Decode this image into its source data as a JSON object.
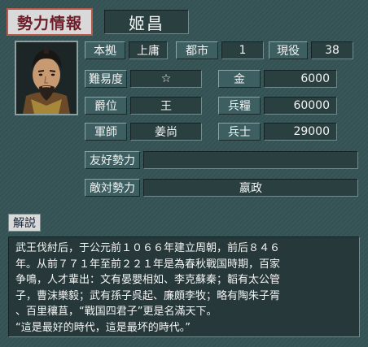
{
  "header": {
    "title": "勢力情報",
    "ruler_name": "姬昌"
  },
  "portrait": {
    "icon": "ruler-portrait-icon"
  },
  "row1": {
    "base_label": "本拠",
    "base_value": "上庸",
    "cities_label": "都市",
    "cities_value": "1",
    "officers_label": "現役",
    "officers_value": "38"
  },
  "stats": {
    "difficulty_label": "難易度",
    "difficulty_value": "☆",
    "gold_label": "金",
    "gold_value": "6000",
    "rank_label": "爵位",
    "rank_value": "王",
    "food_label": "兵糧",
    "food_value": "60000",
    "advisor_label": "軍師",
    "advisor_value": "姜尚",
    "soldiers_label": "兵士",
    "soldiers_value": "29000"
  },
  "relations": {
    "friendly_label": "友好勢力",
    "friendly_value": "",
    "hostile_label": "敵対勢力",
    "hostile_value": "嬴政"
  },
  "description": {
    "heading": "解説",
    "lines": [
      "武王伐紂后，于公元前１０６６年建立周朝，前后８４６",
      "年。从前７７１年至前２２１年是為春秋戰国時期，百家",
      "争鳴，人才輩出：文有晏嬰相如、李克蘇秦；韜有太公管",
      "子，曹沫樂毅；武有孫子呉起、廉頗李牧；略有陶朱子胥",
      "、百里穰苴，“戰国四君子”更是名滿天下。",
      "“這是最好的時代，這是最坏的時代。”"
    ]
  },
  "colors": {
    "background": "#355456",
    "title_text": "#6e1e2a",
    "title_border": "#b55a4a",
    "label_bg": "#3e5f61",
    "value_bg": "#2a3f40"
  }
}
